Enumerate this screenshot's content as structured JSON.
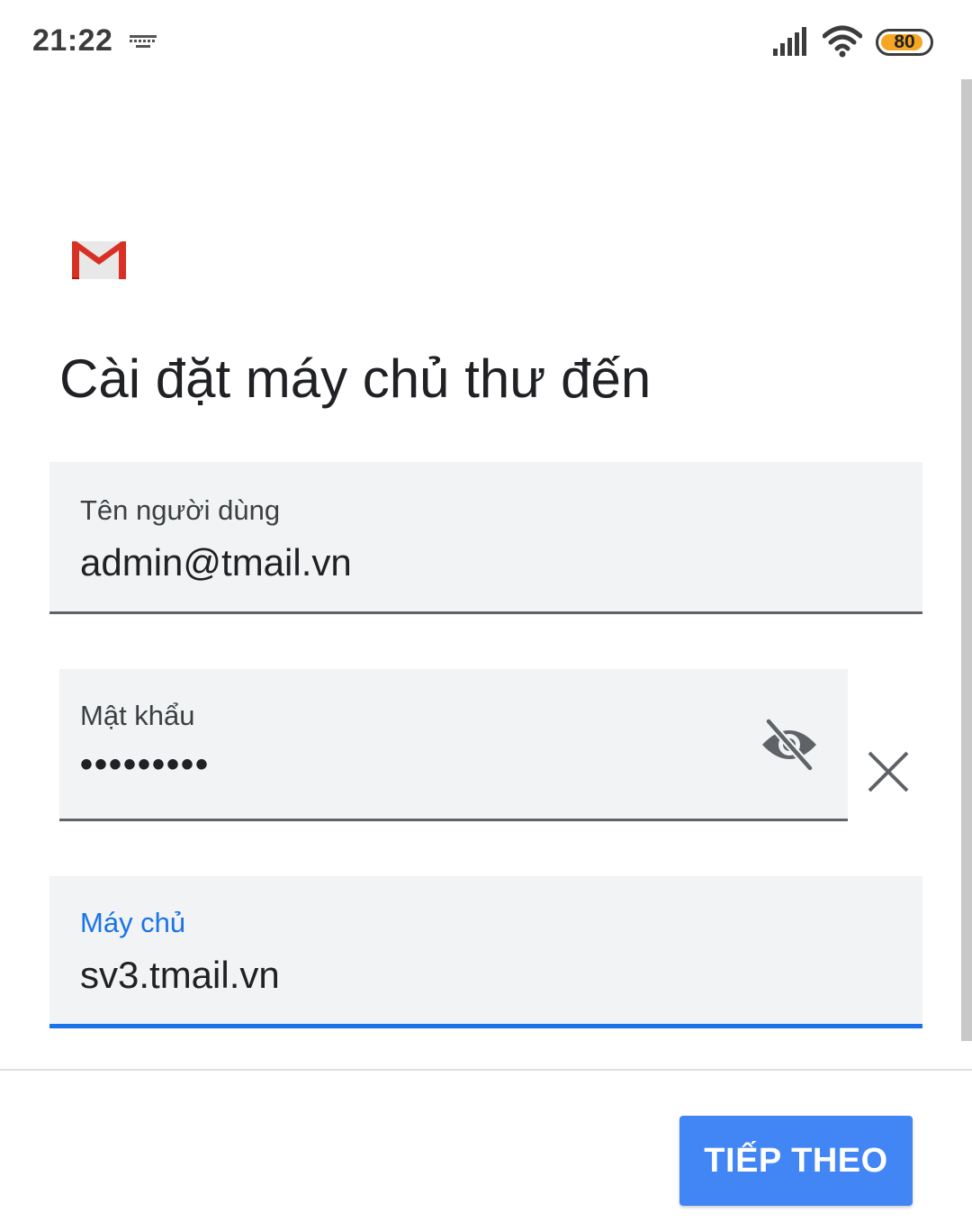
{
  "status_bar": {
    "time": "21:22",
    "battery_level": "80",
    "battery_fraction": 0.8
  },
  "icons": {
    "keyboard": "keyboard-icon",
    "signal": "signal-icon",
    "wifi": "wifi-icon",
    "battery": "battery-icon",
    "logo": "gmail-logo",
    "visibility": "visibility-off-icon",
    "clear": "close-icon"
  },
  "page": {
    "title": "Cài đặt máy chủ thư đến"
  },
  "fields": {
    "username": {
      "label": "Tên người dùng",
      "value": "admin@tmail.vn"
    },
    "password": {
      "label": "Mật khẩu",
      "value": "•••••••••"
    },
    "server": {
      "label": "Máy chủ",
      "value": "sv3.tmail.vn"
    }
  },
  "actions": {
    "next_label": "TIẾP THEO"
  },
  "colors": {
    "accent": "#1a73e8",
    "button": "#4285f4",
    "field_bg": "#f1f3f4",
    "battery_fill": "#f5a623"
  }
}
